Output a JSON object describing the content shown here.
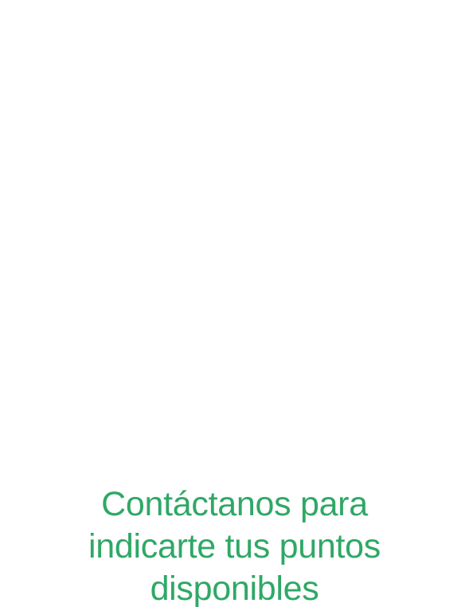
{
  "colors": {
    "background": "#ffffff",
    "text": "#2fa866"
  },
  "message": {
    "lines": [
      "Contáctanos para",
      "indicarte tus puntos",
      "disponibles"
    ]
  }
}
